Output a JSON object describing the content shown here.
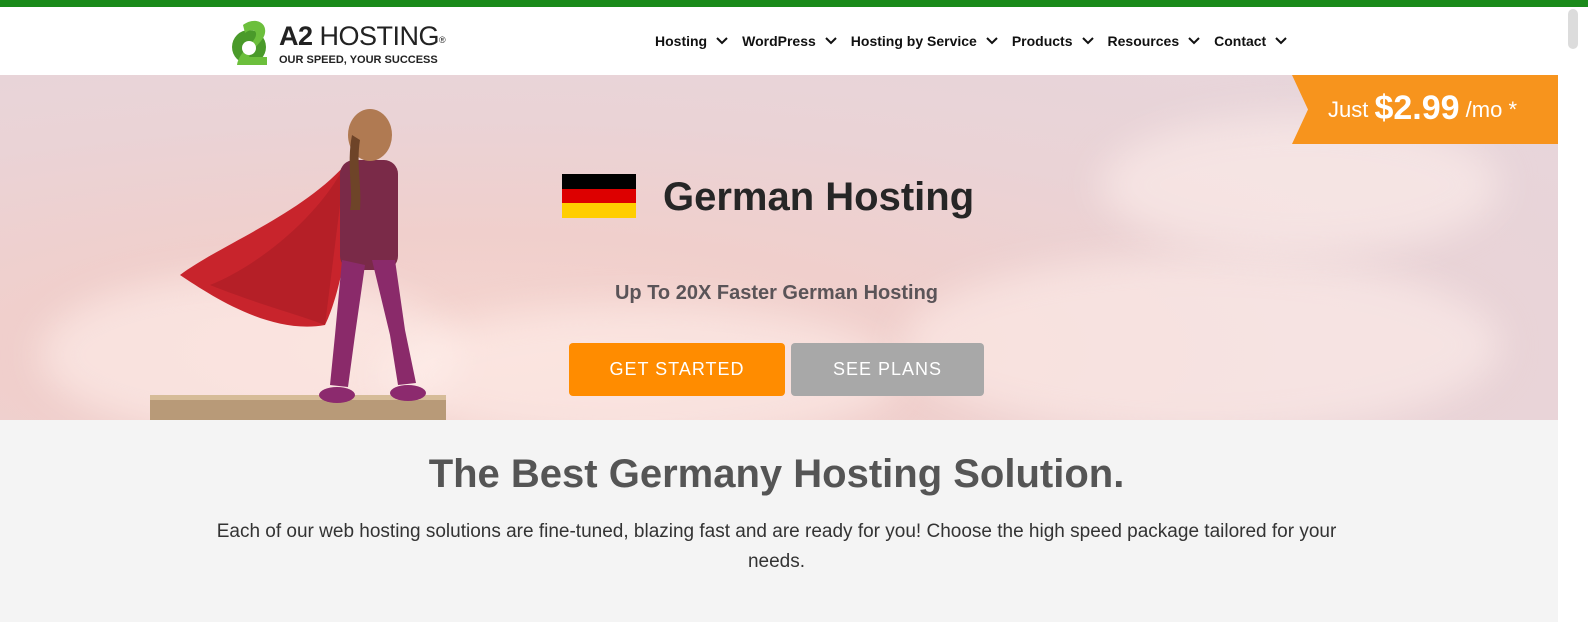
{
  "brand": {
    "name_bold": "A2",
    "name_rest": " HOSTING",
    "registered": "®",
    "tagline": "OUR SPEED, YOUR SUCCESS",
    "colors": {
      "green": "#1a8a1a",
      "orange": "#ff8c00",
      "price_orange": "#f7941d"
    }
  },
  "nav": {
    "items": [
      {
        "label": "Hosting",
        "icon": "chevron-down-icon"
      },
      {
        "label": "WordPress",
        "icon": "chevron-down-icon"
      },
      {
        "label": "Hosting by Service",
        "icon": "chevron-down-icon"
      },
      {
        "label": "Products",
        "icon": "chevron-down-icon"
      },
      {
        "label": "Resources",
        "icon": "chevron-down-icon"
      },
      {
        "label": "Contact",
        "icon": "chevron-down-icon"
      }
    ]
  },
  "hero": {
    "title": "German Hosting",
    "subtitle": "Up To 20X Faster German Hosting",
    "flag_colors": [
      "#000000",
      "#dd0000",
      "#ffce00"
    ],
    "buttons": {
      "get_started": "GET STARTED",
      "see_plans": "SEE PLANS"
    },
    "price": {
      "prefix": "Just ",
      "amount": "$2.99",
      "suffix": " /mo *"
    }
  },
  "section": {
    "title": "The Best Germany Hosting Solution.",
    "description": "Each of our web hosting solutions are fine-tuned, blazing fast and are ready for you! Choose the high speed package tailored for your needs."
  }
}
